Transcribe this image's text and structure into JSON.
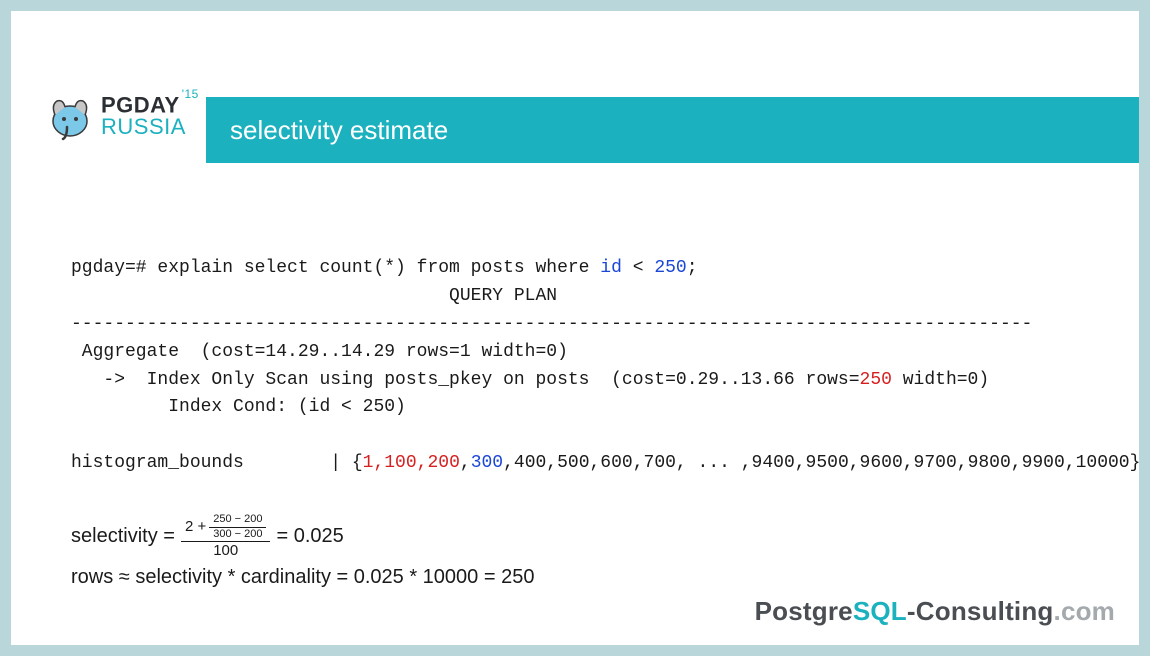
{
  "logo": {
    "line1": "PGDAY",
    "year": "'15",
    "line2": "RUSSIA"
  },
  "title": "selectivity estimate",
  "sql": {
    "prompt": "pgday=# explain select count(*) from posts where ",
    "cond_col": "id",
    "cond_op": " < ",
    "cond_val": "250",
    "suffix": ";"
  },
  "plan": {
    "heading_pad": "                                   QUERY PLAN",
    "sep": "-----------------------------------------------------------------------------------------",
    "agg": " Aggregate  (cost=14.29..14.29 rows=1 width=0)",
    "scan_a": "   ->  Index Only Scan using posts_pkey on posts  (cost=0.29..13.66 rows=",
    "scan_rows": "250",
    "scan_b": " width=0)",
    "cond": "         Index Cond: (id < 250)"
  },
  "hist": {
    "label": "histogram_bounds        | {",
    "b1": "1,100,200",
    "comma1": ",",
    "b2": "300",
    "rest": ",400,500,600,700, ... ,9400,9500,9600,9700,9800,9900,10000}"
  },
  "formula": {
    "sel_label": "selectivity =",
    "inner_top_prefix": "2 +",
    "inner_num": "250 − 200",
    "inner_den": "300 − 200",
    "outer_den": "100",
    "sel_result": "= 0.025",
    "rows_line": "rows ≈ selectivity * cardinality = 0.025 * 10000 = 250"
  },
  "footer": {
    "a": "Postgre",
    "b": "SQL",
    "c": "-Consulting",
    "d": ".com"
  }
}
